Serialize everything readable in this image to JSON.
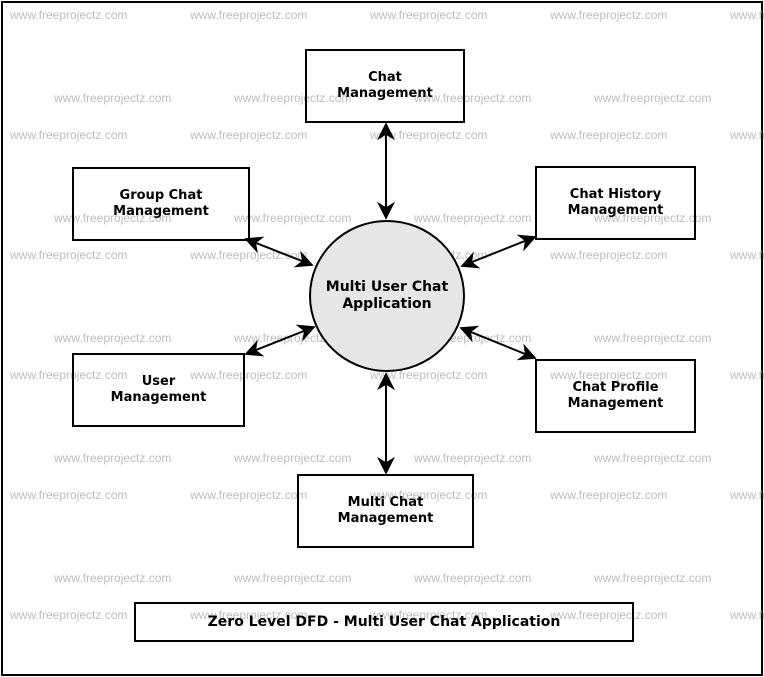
{
  "diagram": {
    "type": "Zero Level DFD",
    "title": "Zero Level DFD - Multi User Chat Application",
    "watermark": "www.freeprojectz.com",
    "process": {
      "label": "Multi User Chat\nApplication",
      "fill": "#e6e6e6"
    },
    "entities": [
      {
        "id": "chat",
        "label": "Chat\nManagement"
      },
      {
        "id": "group-chat",
        "label": "Group Chat\nManagement"
      },
      {
        "id": "chat-history",
        "label": "Chat History\nManagement"
      },
      {
        "id": "user",
        "label": "User\nManagement"
      },
      {
        "id": "chat-profile",
        "label": "Chat Profile\nManagement"
      },
      {
        "id": "multi-chat",
        "label": "Multi Chat\nManagement"
      }
    ],
    "flows": [
      {
        "from": "chat",
        "to": "process",
        "direction": "bidirectional"
      },
      {
        "from": "group-chat",
        "to": "process",
        "direction": "bidirectional"
      },
      {
        "from": "chat-history",
        "to": "process",
        "direction": "bidirectional"
      },
      {
        "from": "user",
        "to": "process",
        "direction": "bidirectional"
      },
      {
        "from": "chat-profile",
        "to": "process",
        "direction": "bidirectional"
      },
      {
        "from": "multi-chat",
        "to": "process",
        "direction": "bidirectional"
      }
    ]
  }
}
